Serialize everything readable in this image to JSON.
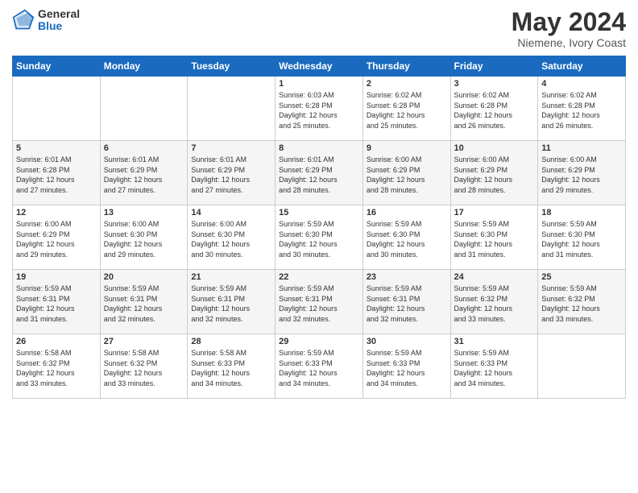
{
  "logo": {
    "general": "General",
    "blue": "Blue"
  },
  "header": {
    "month_year": "May 2024",
    "location": "Niemene, Ivory Coast"
  },
  "weekdays": [
    "Sunday",
    "Monday",
    "Tuesday",
    "Wednesday",
    "Thursday",
    "Friday",
    "Saturday"
  ],
  "weeks": [
    [
      {
        "day": "",
        "info": ""
      },
      {
        "day": "",
        "info": ""
      },
      {
        "day": "",
        "info": ""
      },
      {
        "day": "1",
        "info": "Sunrise: 6:03 AM\nSunset: 6:28 PM\nDaylight: 12 hours\nand 25 minutes."
      },
      {
        "day": "2",
        "info": "Sunrise: 6:02 AM\nSunset: 6:28 PM\nDaylight: 12 hours\nand 25 minutes."
      },
      {
        "day": "3",
        "info": "Sunrise: 6:02 AM\nSunset: 6:28 PM\nDaylight: 12 hours\nand 26 minutes."
      },
      {
        "day": "4",
        "info": "Sunrise: 6:02 AM\nSunset: 6:28 PM\nDaylight: 12 hours\nand 26 minutes."
      }
    ],
    [
      {
        "day": "5",
        "info": "Sunrise: 6:01 AM\nSunset: 6:28 PM\nDaylight: 12 hours\nand 27 minutes."
      },
      {
        "day": "6",
        "info": "Sunrise: 6:01 AM\nSunset: 6:29 PM\nDaylight: 12 hours\nand 27 minutes."
      },
      {
        "day": "7",
        "info": "Sunrise: 6:01 AM\nSunset: 6:29 PM\nDaylight: 12 hours\nand 27 minutes."
      },
      {
        "day": "8",
        "info": "Sunrise: 6:01 AM\nSunset: 6:29 PM\nDaylight: 12 hours\nand 28 minutes."
      },
      {
        "day": "9",
        "info": "Sunrise: 6:00 AM\nSunset: 6:29 PM\nDaylight: 12 hours\nand 28 minutes."
      },
      {
        "day": "10",
        "info": "Sunrise: 6:00 AM\nSunset: 6:29 PM\nDaylight: 12 hours\nand 28 minutes."
      },
      {
        "day": "11",
        "info": "Sunrise: 6:00 AM\nSunset: 6:29 PM\nDaylight: 12 hours\nand 29 minutes."
      }
    ],
    [
      {
        "day": "12",
        "info": "Sunrise: 6:00 AM\nSunset: 6:29 PM\nDaylight: 12 hours\nand 29 minutes."
      },
      {
        "day": "13",
        "info": "Sunrise: 6:00 AM\nSunset: 6:30 PM\nDaylight: 12 hours\nand 29 minutes."
      },
      {
        "day": "14",
        "info": "Sunrise: 6:00 AM\nSunset: 6:30 PM\nDaylight: 12 hours\nand 30 minutes."
      },
      {
        "day": "15",
        "info": "Sunrise: 5:59 AM\nSunset: 6:30 PM\nDaylight: 12 hours\nand 30 minutes."
      },
      {
        "day": "16",
        "info": "Sunrise: 5:59 AM\nSunset: 6:30 PM\nDaylight: 12 hours\nand 30 minutes."
      },
      {
        "day": "17",
        "info": "Sunrise: 5:59 AM\nSunset: 6:30 PM\nDaylight: 12 hours\nand 31 minutes."
      },
      {
        "day": "18",
        "info": "Sunrise: 5:59 AM\nSunset: 6:30 PM\nDaylight: 12 hours\nand 31 minutes."
      }
    ],
    [
      {
        "day": "19",
        "info": "Sunrise: 5:59 AM\nSunset: 6:31 PM\nDaylight: 12 hours\nand 31 minutes."
      },
      {
        "day": "20",
        "info": "Sunrise: 5:59 AM\nSunset: 6:31 PM\nDaylight: 12 hours\nand 32 minutes."
      },
      {
        "day": "21",
        "info": "Sunrise: 5:59 AM\nSunset: 6:31 PM\nDaylight: 12 hours\nand 32 minutes."
      },
      {
        "day": "22",
        "info": "Sunrise: 5:59 AM\nSunset: 6:31 PM\nDaylight: 12 hours\nand 32 minutes."
      },
      {
        "day": "23",
        "info": "Sunrise: 5:59 AM\nSunset: 6:31 PM\nDaylight: 12 hours\nand 32 minutes."
      },
      {
        "day": "24",
        "info": "Sunrise: 5:59 AM\nSunset: 6:32 PM\nDaylight: 12 hours\nand 33 minutes."
      },
      {
        "day": "25",
        "info": "Sunrise: 5:59 AM\nSunset: 6:32 PM\nDaylight: 12 hours\nand 33 minutes."
      }
    ],
    [
      {
        "day": "26",
        "info": "Sunrise: 5:58 AM\nSunset: 6:32 PM\nDaylight: 12 hours\nand 33 minutes."
      },
      {
        "day": "27",
        "info": "Sunrise: 5:58 AM\nSunset: 6:32 PM\nDaylight: 12 hours\nand 33 minutes."
      },
      {
        "day": "28",
        "info": "Sunrise: 5:58 AM\nSunset: 6:33 PM\nDaylight: 12 hours\nand 34 minutes."
      },
      {
        "day": "29",
        "info": "Sunrise: 5:59 AM\nSunset: 6:33 PM\nDaylight: 12 hours\nand 34 minutes."
      },
      {
        "day": "30",
        "info": "Sunrise: 5:59 AM\nSunset: 6:33 PM\nDaylight: 12 hours\nand 34 minutes."
      },
      {
        "day": "31",
        "info": "Sunrise: 5:59 AM\nSunset: 6:33 PM\nDaylight: 12 hours\nand 34 minutes."
      },
      {
        "day": "",
        "info": ""
      }
    ]
  ]
}
